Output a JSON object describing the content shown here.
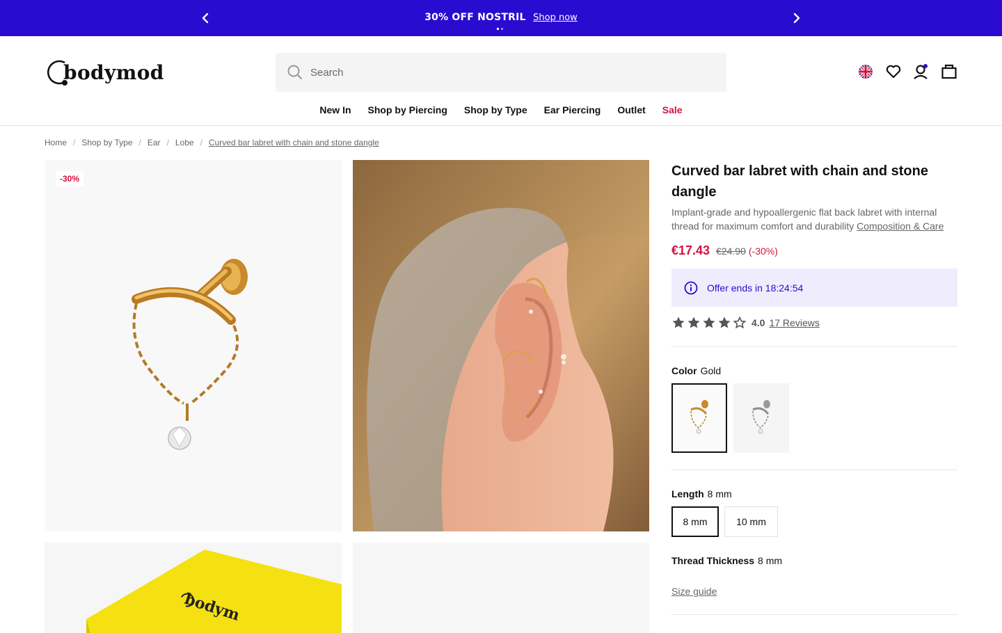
{
  "promo": {
    "headline": "30% OFF NOSTRIL",
    "link": "Shop now",
    "prev_icon": "chevron-left-icon",
    "next_icon": "chevron-right-icon",
    "color": "#2a0bd0"
  },
  "header": {
    "logo_text": "bodymod",
    "search_placeholder": "Search",
    "icons": [
      "uk-flag-icon",
      "heart-icon",
      "user-icon",
      "bag-icon"
    ]
  },
  "nav": {
    "items": [
      "New In",
      "Shop by Piercing",
      "Shop by Type",
      "Ear Piercing",
      "Outlet",
      "Sale"
    ]
  },
  "breadcrumb": [
    "Home",
    "Shop by Type",
    "Ear",
    "Lobe",
    "Curved bar labret with chain and stone dangle"
  ],
  "gallery": {
    "badge": "-30%",
    "box_logo_text": "bodym"
  },
  "product": {
    "title": "Curved bar labret with chain and stone dangle",
    "description": "Implant-grade and hypoallergenic flat back labret with internal thread for maximum comfort and durability",
    "composition_link": "Composition & Care",
    "price_now": "€17.43",
    "price_was": "€24.90",
    "discount": "(-30%)",
    "offer_text": "Offer ends in 18:24:54",
    "rating_value": "4.0",
    "rating_stars": 4,
    "reviews_link": "17 Reviews",
    "color_label": "Color",
    "color_value": "Gold",
    "color_options": [
      "Gold",
      "Silver"
    ],
    "length_label": "Length",
    "length_value": "8 mm",
    "length_options": [
      "8 mm",
      "10 mm"
    ],
    "thread_label": "Thread Thickness",
    "thread_value": "8 mm",
    "size_guide": "Size guide",
    "accent": "#d3123f"
  }
}
